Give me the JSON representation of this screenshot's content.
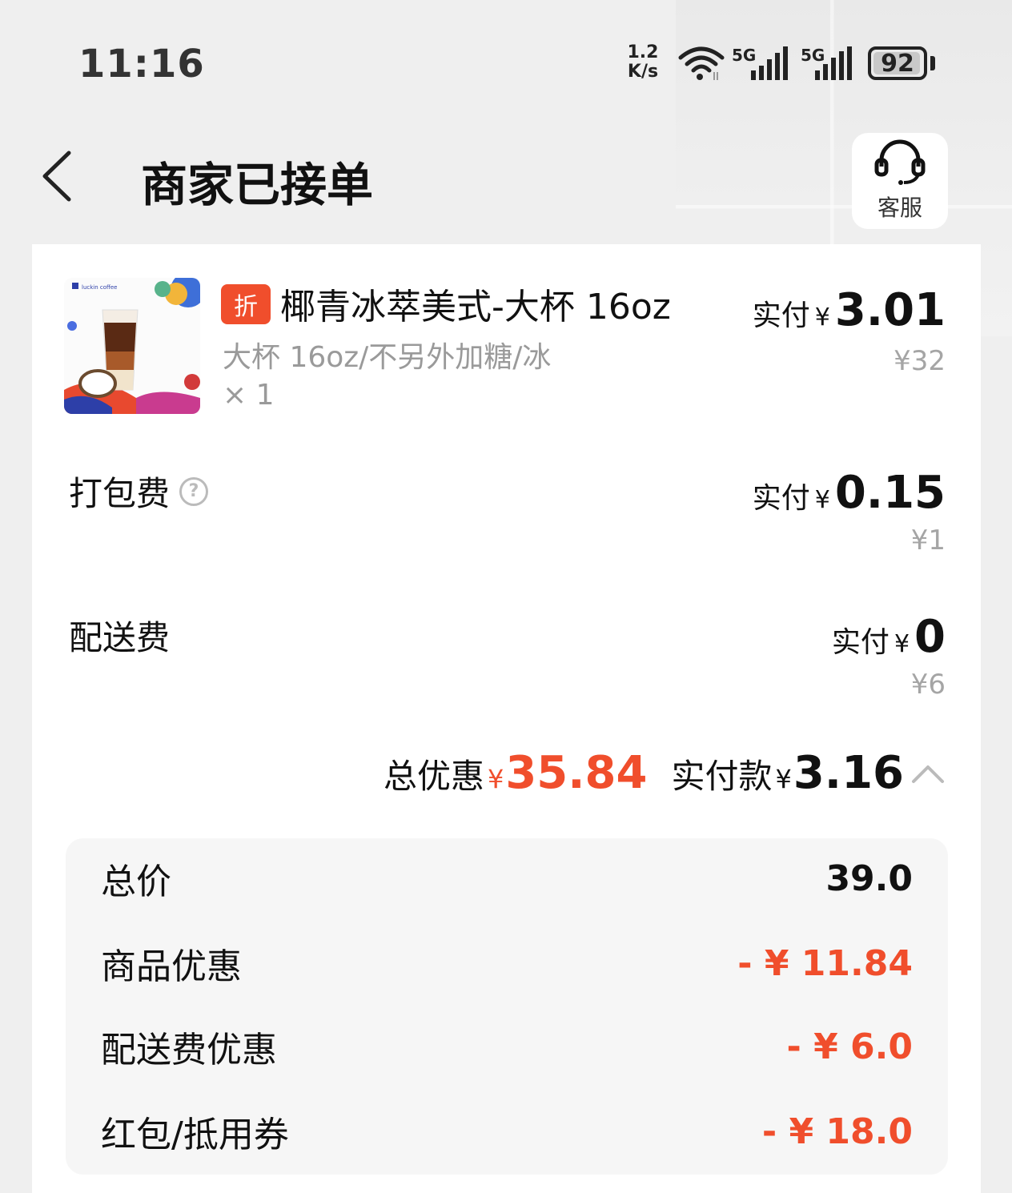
{
  "status_bar": {
    "time": "11:16",
    "net_speed_value": "1.2",
    "net_speed_unit": "K/s",
    "sim1_label": "5G",
    "sim2_label": "5G",
    "battery": "92"
  },
  "header": {
    "title": "商家已接单",
    "service_label": "客服"
  },
  "product": {
    "badge": "折",
    "name": "椰青冰萃美式-大杯 16oz",
    "spec": "大杯 16oz/不另外加糖/冰",
    "qty": "× 1",
    "paid_label": "实付",
    "yen": "¥",
    "paid_amount": "3.01",
    "original_price": "¥32",
    "image_brand_text": "luckin coffee"
  },
  "packing_fee": {
    "label": "打包费",
    "help_icon": "?",
    "paid_label": "实付",
    "yen": "¥",
    "paid_amount": "0.15",
    "original_price": "¥1"
  },
  "delivery_fee": {
    "label": "配送费",
    "paid_label": "实付",
    "yen": "¥",
    "paid_amount": "0",
    "original_price": "¥6"
  },
  "summary": {
    "discount_label": "总优惠",
    "discount_yen": "¥",
    "discount_amount": "35.84",
    "paid_label": "实付款",
    "paid_yen": "¥",
    "paid_amount": "3.16"
  },
  "breakdown": [
    {
      "label": "总价",
      "value": "39.0"
    },
    {
      "label": "商品优惠",
      "value": "- ¥ 11.84"
    },
    {
      "label": "配送费优惠",
      "value": "- ¥ 6.0"
    },
    {
      "label": "红包/抵用券",
      "value": "- ¥ 18.0"
    }
  ],
  "colors": {
    "accent_red": "#f04e2c",
    "muted_gray": "#9a9a9a"
  }
}
